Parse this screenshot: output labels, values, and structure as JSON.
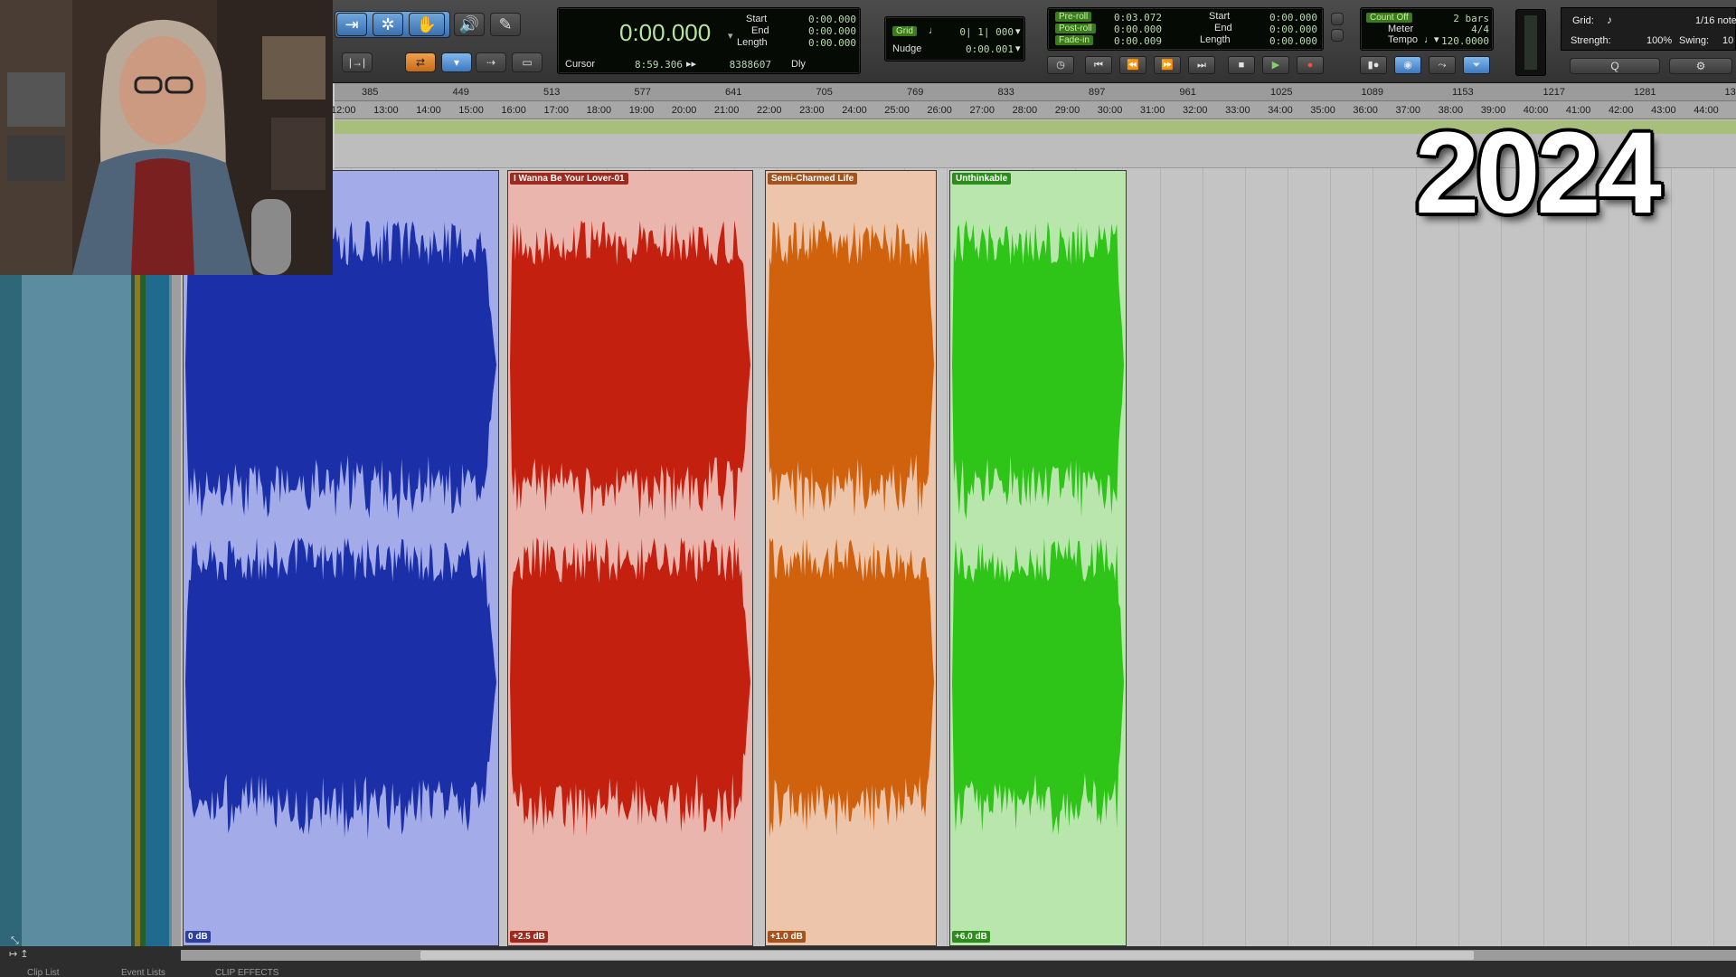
{
  "toolbar": {
    "counter": {
      "main_time": "0:00.000",
      "start_label": "Start",
      "start_value": "0:00.000",
      "end_label": "End",
      "end_value": "0:00.000",
      "length_label": "Length",
      "length_value": "0:00.000",
      "cursor_label": "Cursor",
      "cursor_time": "8:59.306",
      "cursor_samples": "8388607",
      "dly_label": "Dly"
    },
    "grid_nudge": {
      "grid_label": "Grid",
      "grid_value": "0| 1| 000",
      "nudge_label": "Nudge",
      "nudge_value": "0:00.001"
    },
    "preroll": {
      "preroll_label": "Pre-roll",
      "preroll_value": "0:03.072",
      "postroll_label": "Post-roll",
      "postroll_value": "0:00.000",
      "fadein_label": "Fade-in",
      "fadein_value": "0:00.009",
      "start_label": "Start",
      "start_value": "0:00.000",
      "end_label": "End",
      "end_value": "0:00.000",
      "length_label": "Length",
      "length_value": "0:00.000"
    },
    "count": {
      "count_off_label": "Count Off",
      "count_off_value": "2 bars",
      "meter_label": "Meter",
      "meter_value": "4/4",
      "tempo_label": "Tempo",
      "tempo_value": "120.0000"
    },
    "quantize": {
      "grid_label": "Grid:",
      "grid_value": "1/16 note",
      "strength_label": "Strength:",
      "strength_value": "100%",
      "swing_label": "Swing:",
      "swing_value": "10"
    }
  },
  "ruler": {
    "bars": [
      "385",
      "449",
      "513",
      "577",
      "641",
      "705",
      "769",
      "833",
      "897",
      "961",
      "1025",
      "1089",
      "1153",
      "1217",
      "1281",
      "13"
    ],
    "times": [
      "12:00",
      "13:00",
      "14:00",
      "15:00",
      "16:00",
      "17:00",
      "18:00",
      "19:00",
      "20:00",
      "21:00",
      "22:00",
      "23:00",
      "24:00",
      "25:00",
      "26:00",
      "27:00",
      "28:00",
      "29:00",
      "30:00",
      "31:00",
      "32:00",
      "33:00",
      "34:00",
      "35:00",
      "36:00",
      "37:00",
      "38:00",
      "39:00",
      "40:00",
      "41:00",
      "42:00",
      "43:00",
      "44:00"
    ]
  },
  "clips": [
    {
      "name": "",
      "gain": "0 dB",
      "bg": "#a3ace8",
      "wave": "#1a2fa8",
      "label_bg": "#2e3f9e"
    },
    {
      "name": "I Wanna Be Your Lover-01",
      "gain": "+2.5 dB",
      "bg": "#e9b5ad",
      "wave": "#c4200f",
      "label_bg": "#9c2a1e"
    },
    {
      "name": "Semi-Charmed Life",
      "gain": "+1.0 dB",
      "bg": "#edc5aa",
      "wave": "#d0620e",
      "label_bg": "#a5531c"
    },
    {
      "name": "Unthinkable",
      "gain": "+6.0 dB",
      "bg": "#b9e6ad",
      "wave": "#2ec418",
      "label_bg": "#2b8d1a"
    }
  ],
  "bottom_tabs": [
    "Clip List",
    "Event Lists",
    "CLIP EFFECTS"
  ],
  "overlay": {
    "year": "2024"
  },
  "colors": {
    "counter_green": "#b7e49c",
    "track_bg": "#c4c4c4",
    "left_panel": "#5c8ca0"
  }
}
